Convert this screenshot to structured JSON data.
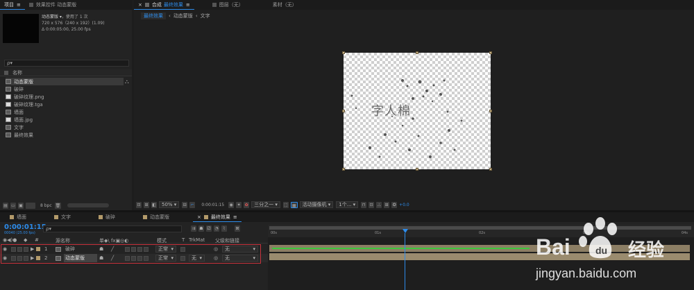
{
  "project_panel": {
    "tab_project": "项目",
    "tab_effects": "效果控件 动态蒙版",
    "item_name": "动态蒙版 ▾",
    "item_used": "，使用了 1 次",
    "item_size": "720 x 576（240 x 192）(1.09)",
    "item_duration": "Δ 0:00:05:00, 25.00 fps",
    "search_placeholder": "ρ▾",
    "col_name": "名称",
    "items": [
      {
        "label": "动态蒙版",
        "type": "comp",
        "selected": true
      },
      {
        "label": "破碎",
        "type": "comp",
        "selected": false
      },
      {
        "label": "破碎纹理.png",
        "type": "img",
        "selected": false
      },
      {
        "label": "破碎纹理.tga",
        "type": "img",
        "selected": false
      },
      {
        "label": "墙面",
        "type": "comp",
        "selected": false
      },
      {
        "label": "墙面.jpg",
        "type": "img",
        "selected": false
      },
      {
        "label": "文字",
        "type": "comp",
        "selected": false
      },
      {
        "label": "最终效果",
        "type": "comp",
        "selected": false
      }
    ],
    "bpc": "8 bpc"
  },
  "comp_panel": {
    "tab_prefix": "合成",
    "tab_name": "最终效果",
    "tab_layer": "图层（无）",
    "tab_footage": "素材（无）",
    "breadcrumbs": [
      "最终效果",
      "动态蒙版",
      "文字"
    ],
    "canvas_text": "字人棉",
    "toolbar": {
      "zoom": "50%",
      "timecode": "0:00:01:15",
      "resolution": "三分之一",
      "camera": "活动摄像机",
      "views": "1个...",
      "exposure": "+0.0"
    }
  },
  "timeline": {
    "tabs": [
      {
        "label": "墙面",
        "active": false
      },
      {
        "label": "文字",
        "active": false
      },
      {
        "label": "破碎",
        "active": false
      },
      {
        "label": "动态蒙版",
        "active": false
      },
      {
        "label": "最终效果",
        "active": true
      }
    ],
    "timecode": "0:00:01:15",
    "fps_sub": "00040 (25.00 fps)",
    "search_placeholder": "ρ▾",
    "headers": {
      "num": "#",
      "source": "源名称",
      "switches": "单◆\\ fx▣◎◐",
      "mode": "模式",
      "t": "T",
      "trkmat": "TrkMat",
      "parent": "父级和链接"
    },
    "layers": [
      {
        "index": "1",
        "name": "破碎",
        "mode": "正常",
        "trkmat": "",
        "parent": "无"
      },
      {
        "index": "2",
        "name": "动态蒙版",
        "mode": "正常",
        "trkmat": "无",
        "parent": "无"
      }
    ],
    "ruler": [
      "00s",
      "01s",
      "02s",
      "03s",
      "04s"
    ]
  },
  "watermark": {
    "logo_text": "Bai",
    "logo_text2": "经验",
    "url": "jingyan.baidu.com"
  },
  "colors": {
    "accent": "#2d8ceb",
    "layer_tan": "#b39a6a",
    "highlight_red": "#c8323c",
    "track_green": "#3cc83c"
  }
}
